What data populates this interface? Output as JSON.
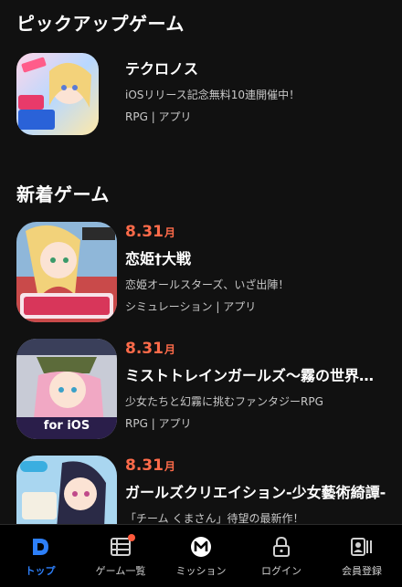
{
  "pickup": {
    "title": "ピックアップゲーム",
    "game": {
      "title": "テクロノス",
      "description": "iOSリリース記念無料10連開催中！",
      "category": "RPG | アプリ"
    }
  },
  "new_games": {
    "title": "新着ゲーム",
    "items": [
      {
        "date": "8.31",
        "month_suffix": "月",
        "title": "恋姫†大戦",
        "description": "恋姫オールスターズ、いざ出陣！",
        "category": "シミュレーション | アプリ"
      },
      {
        "date": "8.31",
        "month_suffix": "月",
        "title": "ミストトレインガールズ〜霧の世界…",
        "description": "少女たちと幻霧に挑むファンタジーRPG",
        "category": "RPG | アプリ",
        "thumb_text": "for iOS"
      },
      {
        "date": "8.31",
        "month_suffix": "月",
        "title": "ガールズクリエイション-少女藝術綺譚-",
        "description": "「チーム くまさん」待望の最新作！"
      }
    ]
  },
  "tabbar": {
    "items": [
      {
        "label": "トップ",
        "icon": "home-d-icon",
        "active": true
      },
      {
        "label": "ゲーム一覧",
        "icon": "list-icon",
        "badge": true
      },
      {
        "label": "ミッション",
        "icon": "mission-m-icon"
      },
      {
        "label": "ログイン",
        "icon": "lock-icon"
      },
      {
        "label": "会員登録",
        "icon": "member-card-icon"
      }
    ]
  },
  "colors": {
    "background": "#111111",
    "accent_date": "#ff6b4a",
    "active_tab": "#2d7ff9",
    "badge": "#ff5a3c"
  }
}
